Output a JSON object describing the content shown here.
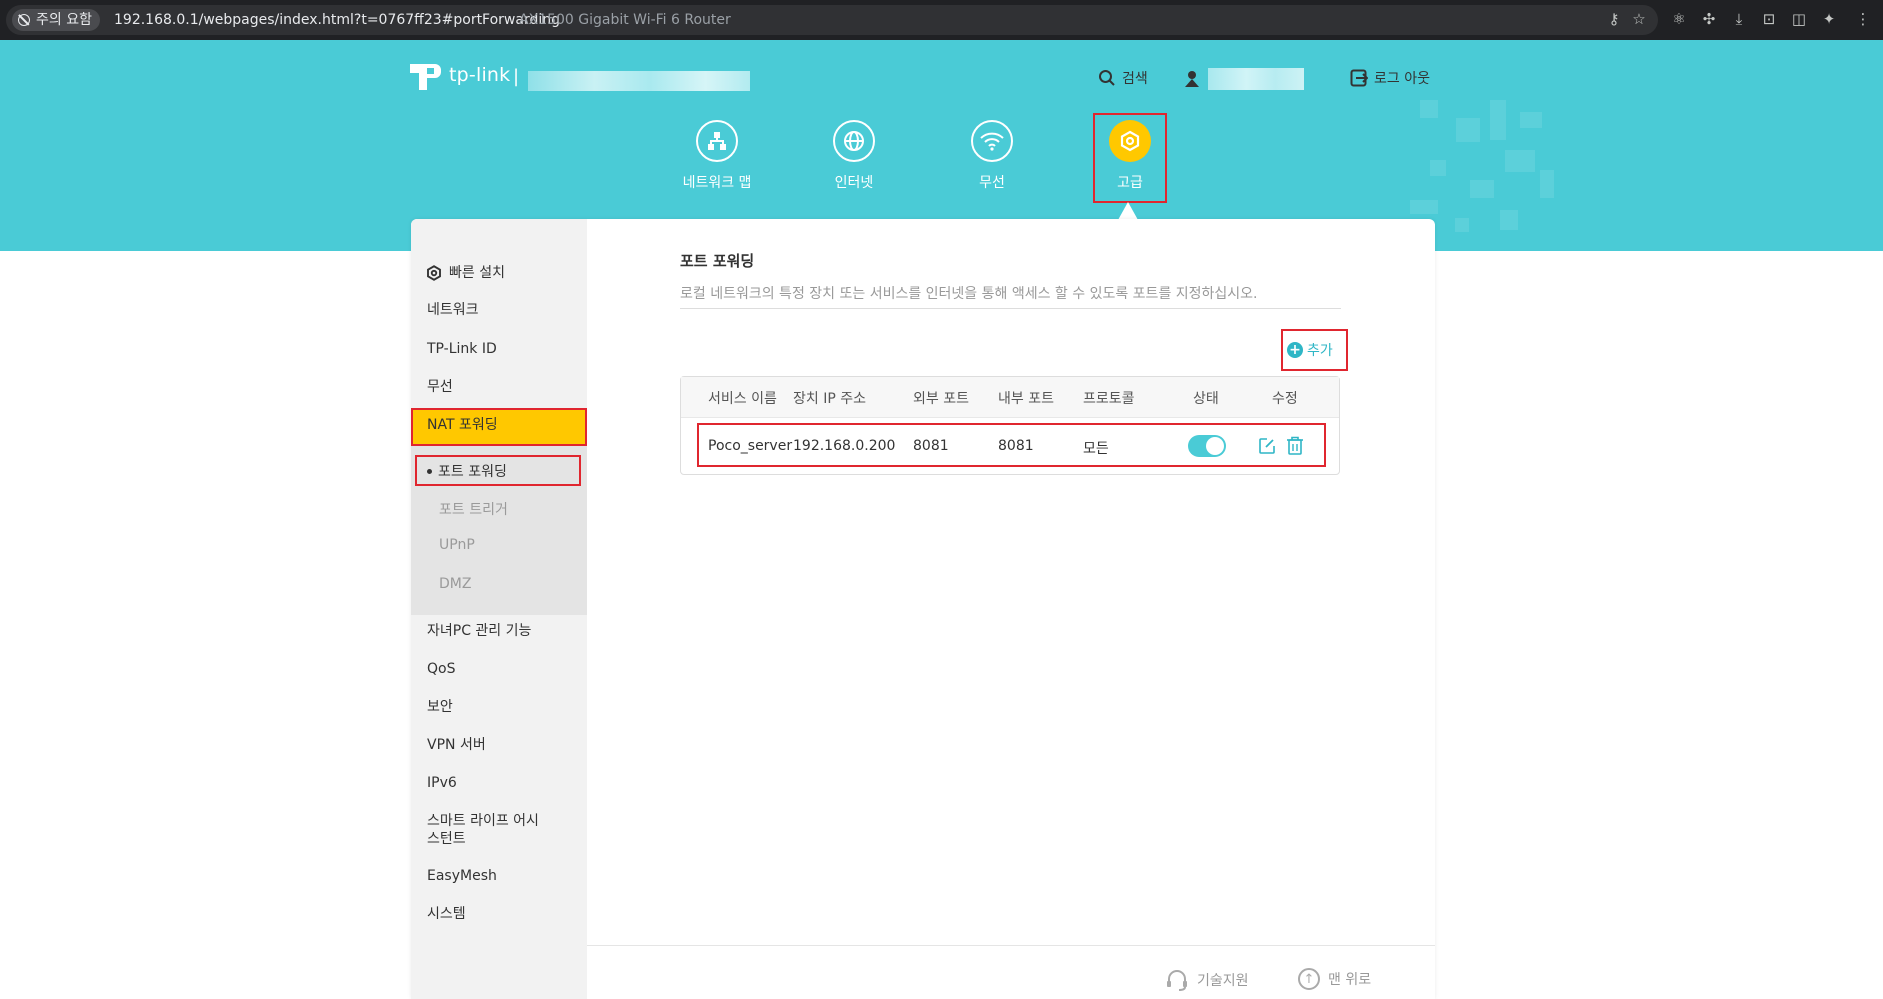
{
  "browser": {
    "security_label": "주의 요함",
    "url": "192.168.0.1/webpages/index.html?t=0767ff23#portForwarding",
    "page_title": "AX1500 Gigabit Wi-Fi 6 Router"
  },
  "header": {
    "logo_text": "tp-link",
    "logo_separator": "|",
    "search_label": "검색",
    "logout_label": "로그 아웃",
    "tabs": [
      {
        "label": "네트워크 맵",
        "icon": "network-map-icon"
      },
      {
        "label": "인터넷",
        "icon": "globe-icon"
      },
      {
        "label": "무선",
        "icon": "wifi-icon"
      },
      {
        "label": "고급",
        "icon": "gear-icon",
        "active": true
      }
    ]
  },
  "sidebar": {
    "quick_setup": "빠른 설치",
    "items_top": [
      "네트워크",
      "TP-Link ID",
      "무선"
    ],
    "nat": "NAT 포워딩",
    "nat_sub": [
      "포트 포워딩",
      "포트 트리거",
      "UPnP",
      "DMZ"
    ],
    "items_bottom": [
      "자녀PC 관리 기능",
      "QoS",
      "보안",
      "VPN 서버",
      "IPv6",
      "스마트 라이프 어시",
      "스턴트",
      "EasyMesh",
      "시스템"
    ]
  },
  "content": {
    "title": "포트 포워딩",
    "description": "로컬 네트워크의 특정 장치 또는 서비스를 인터넷을 통해 액세스 할 수 있도록 포트를 지정하십시오.",
    "add_label": "추가",
    "table": {
      "headers": [
        "서비스 이름",
        "장치 IP 주소",
        "외부 포트",
        "내부 포트",
        "프로토콜",
        "상태",
        "수정"
      ],
      "rows": [
        {
          "service": "Poco_server",
          "ip": "192.168.0.200",
          "external": "8081",
          "internal": "8081",
          "protocol": "모든",
          "enabled": true
        }
      ]
    }
  },
  "footer": {
    "support": "기술지원",
    "top": "맨 위로"
  },
  "colors": {
    "header": "#4acbd6",
    "accent": "#ffc800",
    "highlight_box": "#e0262f",
    "link": "#2fb6c6"
  }
}
